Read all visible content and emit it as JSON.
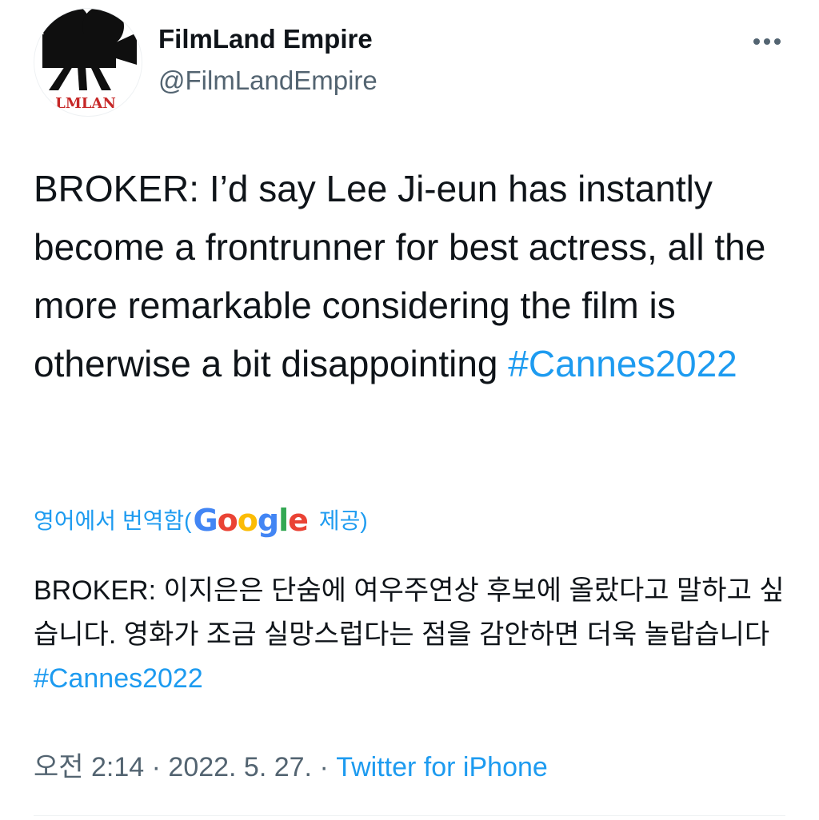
{
  "author": {
    "name": "FilmLand Empire",
    "handle": "@FilmLandEmpire",
    "avatar_text": "LMLAN"
  },
  "tweet": {
    "text": "BROKER: I’d say Lee Ji-eun has instantly become a frontrunner for best actress, all the more remarkable considering the film is otherwise a bit disappointing",
    "hashtag": "#Cannes2022"
  },
  "translation": {
    "label": "영어에서 번역함(",
    "google_letters": [
      "G",
      "o",
      "o",
      "g",
      "l",
      "e"
    ],
    "provided": "제공)",
    "text": "BROKER: 이지은은 단숨에 여우주연상 후보에 올랐다고 말하고 싶습니다. 영화가 조금 실망스럽다는 점을 감안하면 더욱 놀랍습니다",
    "hashtag": "#Cannes2022"
  },
  "meta": {
    "time": "오전 2:14",
    "separator": " · ",
    "date": "2022. 5. 27.",
    "source": "Twitter for iPhone"
  },
  "colors": {
    "link": "#1d9bf0",
    "secondary_text": "#536471",
    "primary_text": "#0f1419",
    "avatar_logo": "#c62828"
  },
  "icons": {
    "more": "more-horizontal-icon",
    "avatar": "film-camera-logo"
  }
}
